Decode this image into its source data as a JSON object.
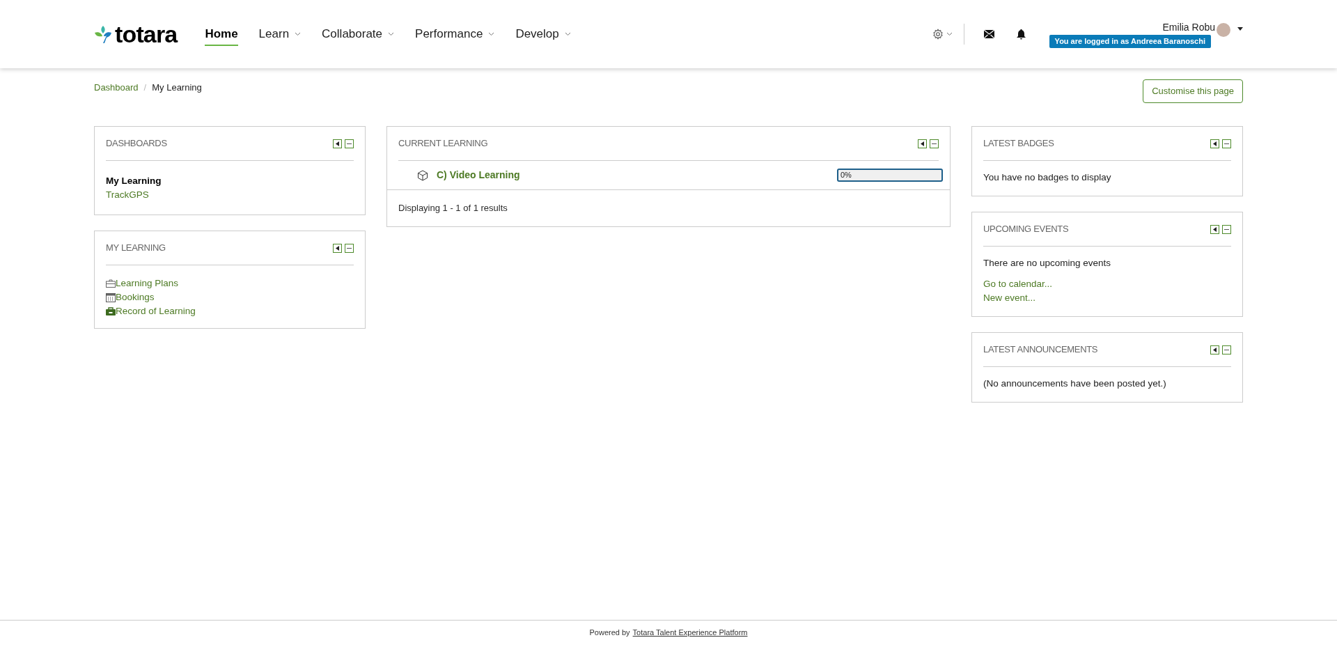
{
  "header": {
    "logo": "totara",
    "nav": [
      {
        "label": "Home",
        "selected": true,
        "dropdown": false
      },
      {
        "label": "Learn",
        "selected": false,
        "dropdown": true
      },
      {
        "label": "Collaborate",
        "selected": false,
        "dropdown": true
      },
      {
        "label": "Performance",
        "selected": false,
        "dropdown": true
      },
      {
        "label": "Develop",
        "selected": false,
        "dropdown": true
      }
    ],
    "user": {
      "name": "Emilia Robu",
      "logged_in_as": "You are logged in as Andreea Baranoschi"
    }
  },
  "breadcrumb": {
    "separator": "/",
    "items": [
      "Dashboard",
      "My Learning"
    ]
  },
  "customise_button": "Customise this page",
  "left_blocks": [
    {
      "title": "DASHBOARDS",
      "kind": "dashboards",
      "items": [
        {
          "label": "My Learning",
          "selected": true
        },
        {
          "label": "TrackGPS",
          "selected": false
        }
      ]
    },
    {
      "title": "MY LEARNING",
      "kind": "links",
      "items": [
        {
          "label": "Learning Plans"
        },
        {
          "label": "Bookings"
        },
        {
          "label": "Record of Learning"
        }
      ]
    }
  ],
  "current_learning": {
    "title": "CURRENT LEARNING",
    "rows": [
      {
        "name": "C) Video Learning",
        "progress": "0%",
        "level": 0
      }
    ],
    "footer": "Displaying 1 - 1 of 1 results"
  },
  "right_blocks": [
    {
      "title": "LATEST BADGES",
      "text": "You have no badges to display"
    },
    {
      "title": "UPCOMING EVENTS",
      "text": "There are no upcoming events",
      "links": [
        "Go to calendar...",
        "New event..."
      ]
    },
    {
      "title": "LATEST ANNOUNCEMENTS",
      "text": "(No announcements have been posted yet.)"
    }
  ],
  "footer": {
    "prefix": "Powered by",
    "link": "Totara Talent Experience Platform"
  }
}
